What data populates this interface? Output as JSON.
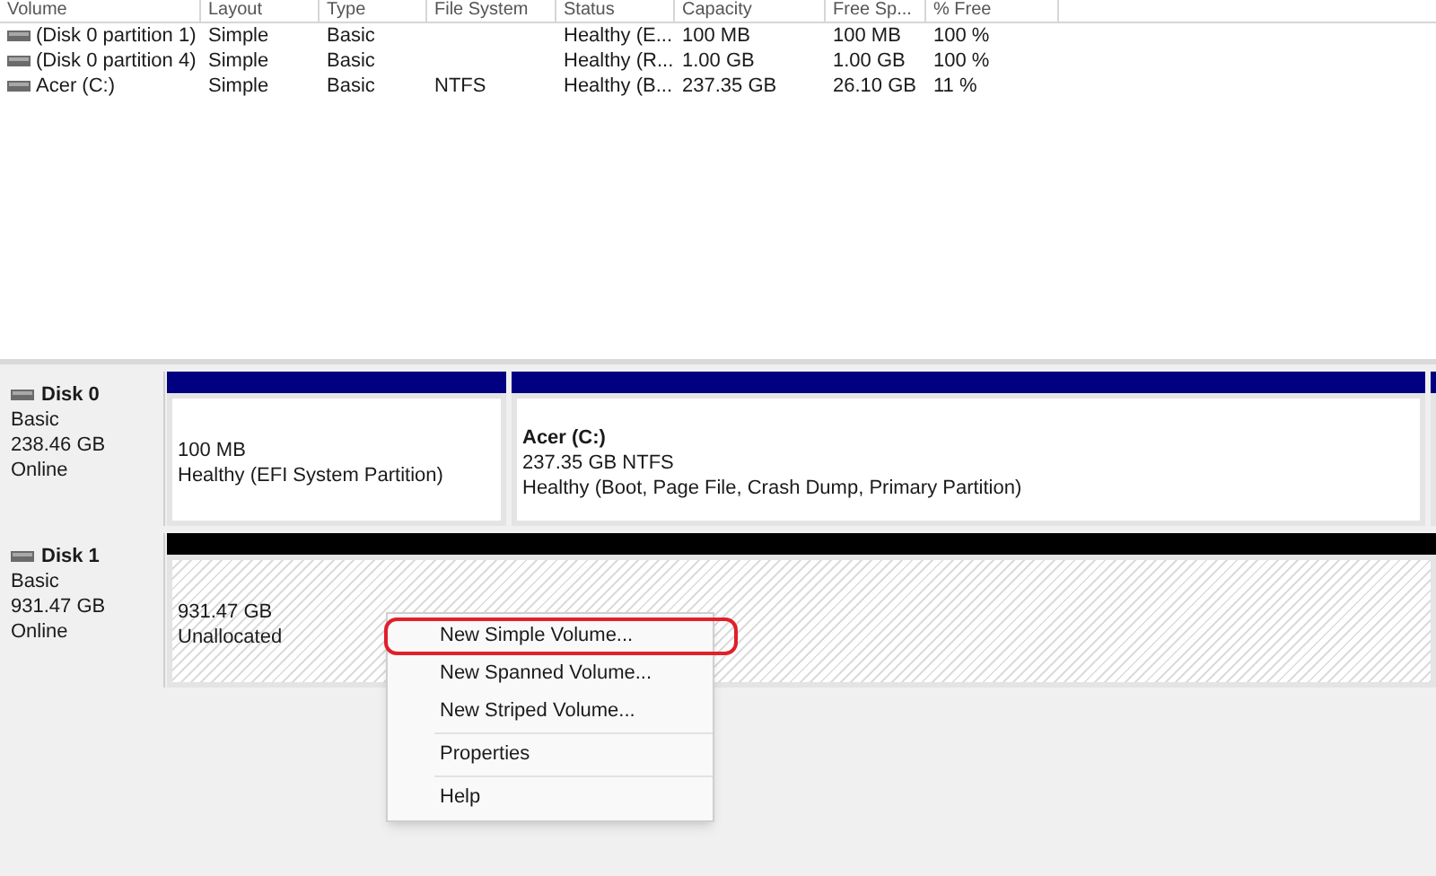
{
  "table": {
    "columns": [
      "Volume",
      "Layout",
      "Type",
      "File System",
      "Status",
      "Capacity",
      "Free Sp...",
      "% Free"
    ],
    "rows": [
      [
        "(Disk 0 partition 1)",
        "Simple",
        "Basic",
        "",
        "Healthy (E...",
        "100 MB",
        "100 MB",
        "100 %"
      ],
      [
        "(Disk 0 partition 4)",
        "Simple",
        "Basic",
        "",
        "Healthy (R...",
        "1.00 GB",
        "1.00 GB",
        "100 %"
      ],
      [
        "Acer (C:)",
        "Simple",
        "Basic",
        "NTFS",
        "Healthy (B...",
        "237.35 GB",
        "26.10 GB",
        "11 %"
      ]
    ]
  },
  "disks": [
    {
      "name": "Disk 0",
      "type": "Basic",
      "size": "238.46 GB",
      "status": "Online",
      "partitions": [
        {
          "kind": "partition",
          "size": "100 MB",
          "status": "Healthy (EFI System Partition)"
        },
        {
          "kind": "partition",
          "title": "Acer  (C:)",
          "size": "237.35 GB NTFS",
          "status": "Healthy (Boot, Page File, Crash Dump, Primary Partition)"
        },
        {
          "kind": "partition"
        }
      ]
    },
    {
      "name": "Disk 1",
      "type": "Basic",
      "size": "931.47 GB",
      "status": "Online",
      "partitions": [
        {
          "kind": "unallocated",
          "size": "931.47 GB",
          "status": "Unallocated"
        }
      ]
    }
  ],
  "context_menu": [
    {
      "kind": "item",
      "label": "New Simple Volume...",
      "highlighted": true
    },
    {
      "kind": "item",
      "label": "New Spanned Volume...",
      "highlighted": false
    },
    {
      "kind": "item",
      "label": "New Striped Volume...",
      "highlighted": false
    },
    {
      "kind": "separator"
    },
    {
      "kind": "item",
      "label": "Properties",
      "highlighted": false
    },
    {
      "kind": "separator"
    },
    {
      "kind": "item",
      "label": "Help",
      "highlighted": false
    }
  ]
}
